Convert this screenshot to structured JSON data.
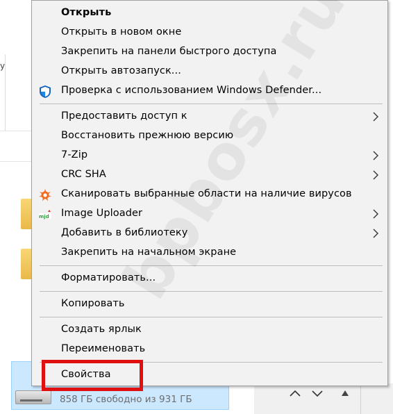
{
  "background": {
    "cut_text": "y",
    "drive_free_text": "858 ГБ свободно из 931 ГБ"
  },
  "menu": {
    "items": [
      {
        "label": "Открыть",
        "bold": true
      },
      {
        "label": "Открыть в новом окне"
      },
      {
        "label": "Закрепить на панели быстрого доступа"
      },
      {
        "label": "Открыть автозапуск..."
      },
      {
        "label": "Проверка с использованием Windows Defender...",
        "icon": "windows-defender-shield-icon"
      },
      {
        "label": "Предоставить доступ к",
        "submenu": true
      },
      {
        "label": "Восстановить прежнюю версию"
      },
      {
        "label": "7-Zip",
        "submenu": true
      },
      {
        "label": "CRC SHA",
        "submenu": true
      },
      {
        "label": "Сканировать выбранные области на наличие вирусов",
        "icon": "avast-icon"
      },
      {
        "label": "Image Uploader",
        "submenu": true,
        "icon": "image-uploader-icon"
      },
      {
        "label": "Добавить в библиотеку",
        "submenu": true
      },
      {
        "label": "Закрепить на начальном экране"
      },
      {
        "label": "Форматировать..."
      },
      {
        "label": "Копировать"
      },
      {
        "label": "Создать ярлык"
      },
      {
        "label": "Переименовать"
      },
      {
        "label": "Свойства",
        "highlighted": true
      }
    ]
  },
  "watermark": "bpbosx.ru",
  "colors": {
    "menu_bg": "#f2f2f2",
    "highlight": "#e01010",
    "selection": "#cce8ff",
    "defender_blue": "#1565c0",
    "avast_orange": "#f26b21"
  }
}
